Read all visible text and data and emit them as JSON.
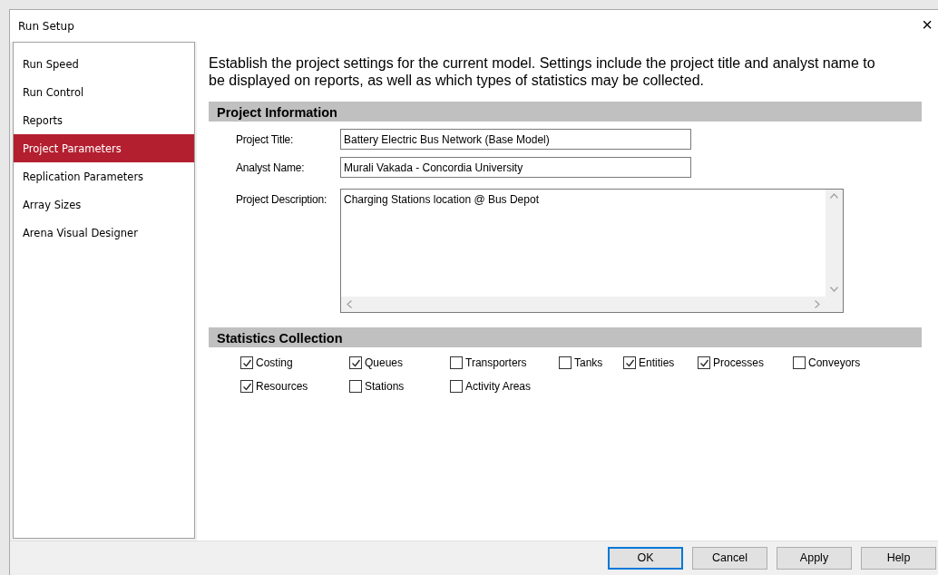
{
  "window": {
    "title": "Run Setup",
    "close": "×"
  },
  "sidebar": {
    "items": [
      {
        "label": "Run Speed",
        "selected": false
      },
      {
        "label": "Run Control",
        "selected": false
      },
      {
        "label": "Reports",
        "selected": false
      },
      {
        "label": "Project Parameters",
        "selected": true
      },
      {
        "label": "Replication Parameters",
        "selected": false
      },
      {
        "label": "Array Sizes",
        "selected": false
      },
      {
        "label": "Arena Visual Designer",
        "selected": false
      }
    ]
  },
  "intro": "Establish the project settings for the current model. Settings include the project title and analyst name to be displayed on reports, as well as which types of statistics may be collected.",
  "project_information": {
    "heading": "Project Information",
    "fields": [
      {
        "label": "Project Title:",
        "value": "Battery Electric Bus Network (Base Model)"
      },
      {
        "label": "Analyst Name:",
        "value": "Murali Vakada - Concordia University"
      }
    ],
    "description": {
      "label": "Project Description:",
      "value": "Charging Stations location @ Bus Depot"
    }
  },
  "statistics_collection": {
    "heading": "Statistics Collection",
    "options": [
      {
        "label": "Costing",
        "checked": true
      },
      {
        "label": "Queues",
        "checked": true
      },
      {
        "label": "Transporters",
        "checked": false
      },
      {
        "label": "Tanks",
        "checked": false
      },
      {
        "label": "Entities",
        "checked": true
      },
      {
        "label": "Processes",
        "checked": true
      },
      {
        "label": "Conveyors",
        "checked": false
      },
      {
        "label": "Resources",
        "checked": true
      },
      {
        "label": "Stations",
        "checked": false
      },
      {
        "label": "Activity Areas",
        "checked": false
      }
    ]
  },
  "buttons": [
    {
      "label": "OK",
      "default": true
    },
    {
      "label": "Cancel",
      "default": false
    },
    {
      "label": "Apply",
      "default": false
    },
    {
      "label": "Help",
      "default": false
    }
  ]
}
